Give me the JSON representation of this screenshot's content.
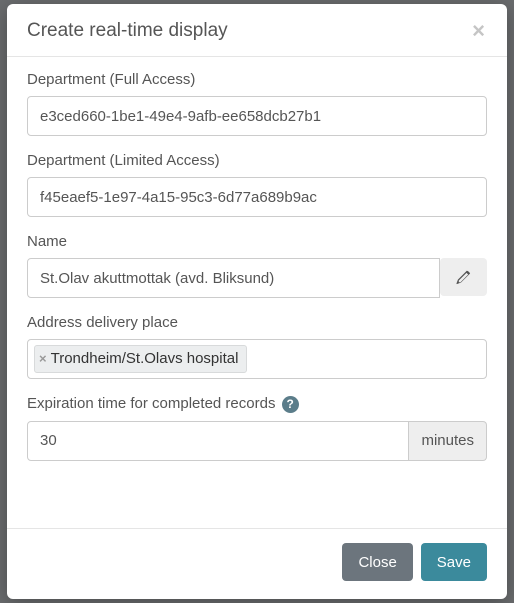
{
  "modal": {
    "title": "Create real-time display"
  },
  "fields": {
    "dept_full": {
      "label": "Department (Full Access)",
      "value": "e3ced660-1be1-49e4-9afb-ee658dcb27b1"
    },
    "dept_limited": {
      "label": "Department (Limited Access)",
      "value": "f45eaef5-1e97-4a15-95c3-6d77a689b9ac"
    },
    "name": {
      "label": "Name",
      "value": "St.Olav akuttmottak (avd. Bliksund)"
    },
    "address": {
      "label": "Address delivery place",
      "tag": "Trondheim/St.Olavs hospital"
    },
    "expiration": {
      "label": "Expiration time for completed records",
      "value": "30",
      "unit": "minutes",
      "help_glyph": "?"
    }
  },
  "footer": {
    "close": "Close",
    "save": "Save"
  }
}
